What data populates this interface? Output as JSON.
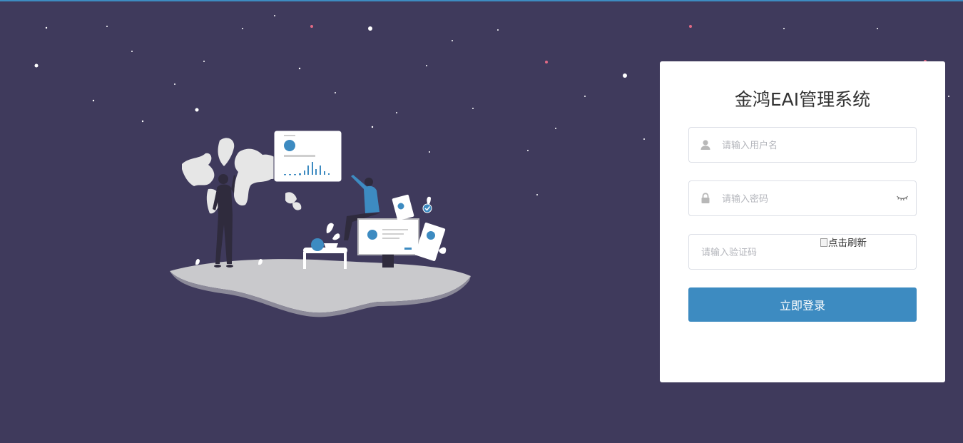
{
  "page": {
    "background": "#3f3a5c",
    "accent": "#3d8bc1"
  },
  "login": {
    "title": "金鸿EAI管理系统",
    "username_placeholder": "请输入用户名",
    "password_placeholder": "请输入密码",
    "captcha_placeholder": "请输入验证码",
    "captcha_alt": "点击刷新",
    "submit_label": "立即登录"
  },
  "icons": {
    "username": "user-icon",
    "password": "lock-icon",
    "toggle_password": "eye-closed-icon"
  }
}
